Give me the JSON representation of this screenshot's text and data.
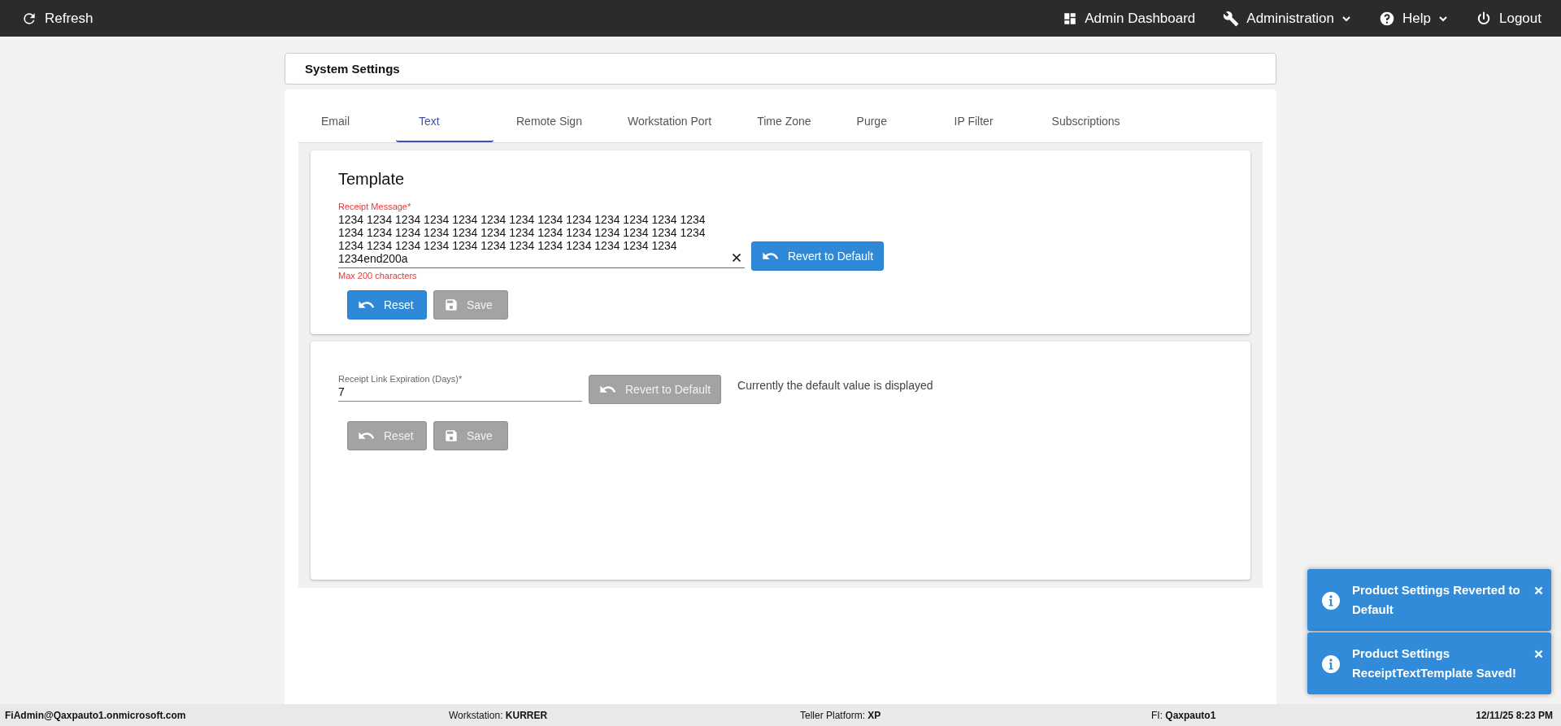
{
  "top_bar": {
    "refresh": {
      "label": "Refresh"
    },
    "menu": [
      {
        "label": "Admin Dashboard",
        "kind": "link"
      },
      {
        "label": "Administration",
        "kind": "dropdown"
      },
      {
        "label": "Help",
        "kind": "dropdown"
      },
      {
        "label": "Logout",
        "kind": "link"
      }
    ]
  },
  "header": {
    "title": "System Settings"
  },
  "tabs": [
    {
      "label": "Email",
      "selected": false
    },
    {
      "label": "Text",
      "selected": true
    },
    {
      "label": "Remote Sign",
      "selected": false
    },
    {
      "label": "Workstation Port",
      "selected": false
    },
    {
      "label": "Time Zone",
      "selected": false
    },
    {
      "label": "Purge",
      "selected": false
    },
    {
      "label": "IP Filter",
      "selected": false
    },
    {
      "label": "Subscriptions",
      "selected": false
    }
  ],
  "cards": [
    {
      "title": "Template",
      "field": {
        "label": "Receipt Message*",
        "value": "1234 1234 1234 1234 1234 1234 1234 1234 1234 1234 1234 1234 1234 1234 1234 1234 1234 1234 1234 1234 1234 1234 1234 1234 1234 1234 1234 1234 1234 1234 1234 1234 1234 1234 1234 1234 1234 1234 1234end200a",
        "error": true,
        "clearable": true,
        "helper": "Max 200 characters"
      },
      "revert": {
        "label": "Revert to Default",
        "kind": "revert",
        "disabled": false
      },
      "actions": [
        {
          "label": "Reset",
          "kind": "reset",
          "disabled": false
        },
        {
          "label": "Save",
          "kind": "save",
          "disabled": true
        }
      ]
    },
    {
      "field": {
        "label": "Receipt Link Expiration (Days)*",
        "value": "7",
        "error": false,
        "clearable": false
      },
      "revert": {
        "label": "Revert to Default",
        "kind": "revert",
        "disabled": true
      },
      "note": "Currently the default value is displayed",
      "actions": [
        {
          "label": "Reset",
          "kind": "reset",
          "disabled": true
        },
        {
          "label": "Save",
          "kind": "save",
          "disabled": true
        }
      ]
    }
  ],
  "toasts": [
    {
      "message": "Product Settings Reverted to Default"
    },
    {
      "message": "Product Settings ReceiptTextTemplate Saved!"
    }
  ],
  "status_bar": [
    {
      "kind": "user",
      "text": "FiAdmin@Qaxpauto1.onmicrosoft.com"
    },
    {
      "kind": "pair",
      "text": "Workstation: **KURRER**"
    },
    {
      "kind": "pair",
      "text": "Teller Platform: **XP**"
    },
    {
      "kind": "pair",
      "text": "FI: **Qaxpauto1**"
    },
    {
      "kind": "time",
      "text": "12/11/25 8:23 PM"
    }
  ]
}
